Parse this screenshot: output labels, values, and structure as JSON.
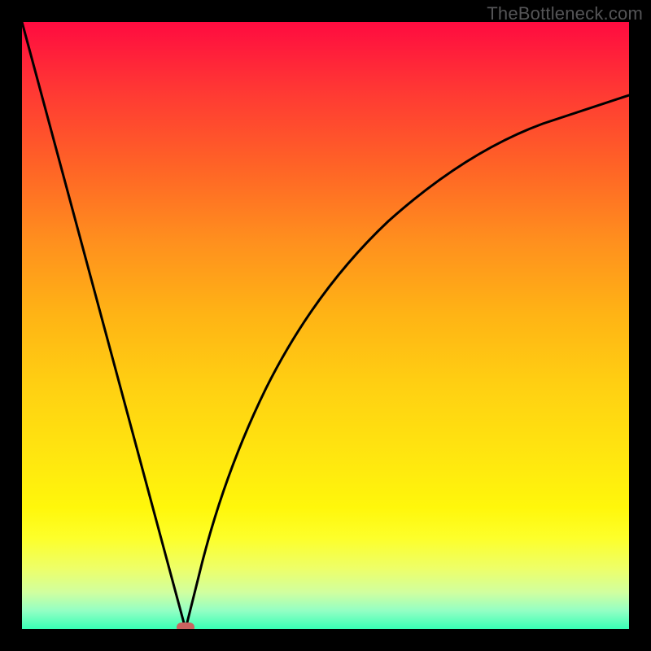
{
  "watermark": "TheBottleneck.com",
  "colors": {
    "page_bg": "#000000",
    "marker": "#ca6260",
    "curve": "#000000"
  },
  "chart_data": {
    "type": "line",
    "title": "",
    "xlabel": "",
    "ylabel": "",
    "xlim": [
      0,
      100
    ],
    "ylim": [
      0,
      100
    ],
    "grid": false,
    "legend": false,
    "series": [
      {
        "name": "left-branch",
        "x": [
          0,
          5,
          10,
          15,
          20,
          25,
          27
        ],
        "values": [
          100,
          81.5,
          63,
          44.5,
          26,
          7.5,
          0
        ]
      },
      {
        "name": "right-branch",
        "x": [
          27,
          29,
          32,
          36,
          41,
          47,
          54,
          62,
          71,
          81,
          90,
          100
        ],
        "values": [
          0,
          8,
          20,
          33,
          45,
          56,
          65,
          72,
          78,
          82.5,
          85.5,
          88
        ]
      }
    ],
    "annotations": [
      {
        "name": "minimum-marker",
        "x": 27,
        "y": 0
      }
    ],
    "background_gradient": {
      "top_color": "#ff0b40",
      "bottom_color": "#37ffb5"
    }
  }
}
